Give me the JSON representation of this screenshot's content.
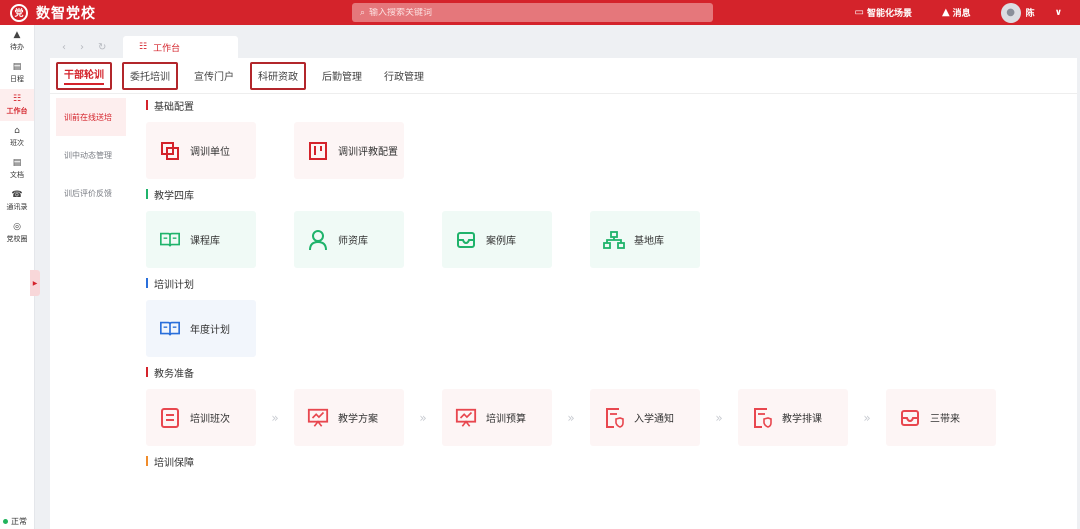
{
  "app": {
    "logo_text": "党",
    "title": "数智党校"
  },
  "search": {
    "placeholder": "输入搜索关键词"
  },
  "topbar": {
    "scene": "智能化场景",
    "message": "消息",
    "user": "陈"
  },
  "leftnav": [
    {
      "label": "待办",
      "icon": "bell-icon"
    },
    {
      "label": "日程",
      "icon": "calendar-icon"
    },
    {
      "label": "工作台",
      "icon": "grid-icon",
      "active": true
    },
    {
      "label": "班次",
      "icon": "home-icon"
    },
    {
      "label": "文档",
      "icon": "document-icon"
    },
    {
      "label": "通讯录",
      "icon": "phone-icon"
    },
    {
      "label": "党校圈",
      "icon": "circle-icon"
    }
  ],
  "status": "正常",
  "page_tab": {
    "label": "工作台"
  },
  "subtabs": [
    {
      "label": "干部轮训",
      "active": true,
      "boxed": true
    },
    {
      "label": "委托培训",
      "boxed": true
    },
    {
      "label": "宣传门户"
    },
    {
      "label": "科研资政",
      "boxed": true
    },
    {
      "label": "后勤管理"
    },
    {
      "label": "行政管理"
    }
  ],
  "sidemenu": [
    {
      "label": "训前在线送培",
      "active": true
    },
    {
      "label": "训中动态管理"
    },
    {
      "label": "训后评价反馈"
    }
  ],
  "sections": [
    {
      "title": "基础配置",
      "color": "#d4232b",
      "cards": [
        {
          "label": "调训单位",
          "icon": "overlap-squares-icon",
          "tone": "red"
        },
        {
          "label": "调训评教配置",
          "icon": "kanban-icon",
          "tone": "red"
        }
      ]
    },
    {
      "title": "教学四库",
      "color": "#1fb36b",
      "cards": [
        {
          "label": "课程库",
          "icon": "book-open-icon",
          "tone": "green"
        },
        {
          "label": "师资库",
          "icon": "person-icon",
          "tone": "green"
        },
        {
          "label": "案例库",
          "icon": "inbox-icon",
          "tone": "green"
        },
        {
          "label": "基地库",
          "icon": "org-chart-icon",
          "tone": "green"
        }
      ]
    },
    {
      "title": "培训计划",
      "color": "#2a6fdb",
      "cards": [
        {
          "label": "年度计划",
          "icon": "book-open-icon",
          "tone": "blue"
        }
      ]
    },
    {
      "title": "教务准备",
      "color": "#d4232b",
      "flow": true,
      "cards": [
        {
          "label": "培训班次",
          "icon": "list-icon",
          "tone": "red"
        },
        {
          "label": "教学方案",
          "icon": "presentation-icon",
          "tone": "red"
        },
        {
          "label": "培训预算",
          "icon": "presentation-icon",
          "tone": "red"
        },
        {
          "label": "入学通知",
          "icon": "doc-shield-icon",
          "tone": "red"
        },
        {
          "label": "教学排课",
          "icon": "doc-shield-icon",
          "tone": "red"
        },
        {
          "label": "三带来",
          "icon": "inbox-icon",
          "tone": "red"
        }
      ]
    },
    {
      "title": "培训保障",
      "color": "#f08c2b",
      "cards": []
    }
  ],
  "colors": {
    "brand": "#d4232b",
    "green": "#1fb36b",
    "blue": "#2a6fdb"
  }
}
